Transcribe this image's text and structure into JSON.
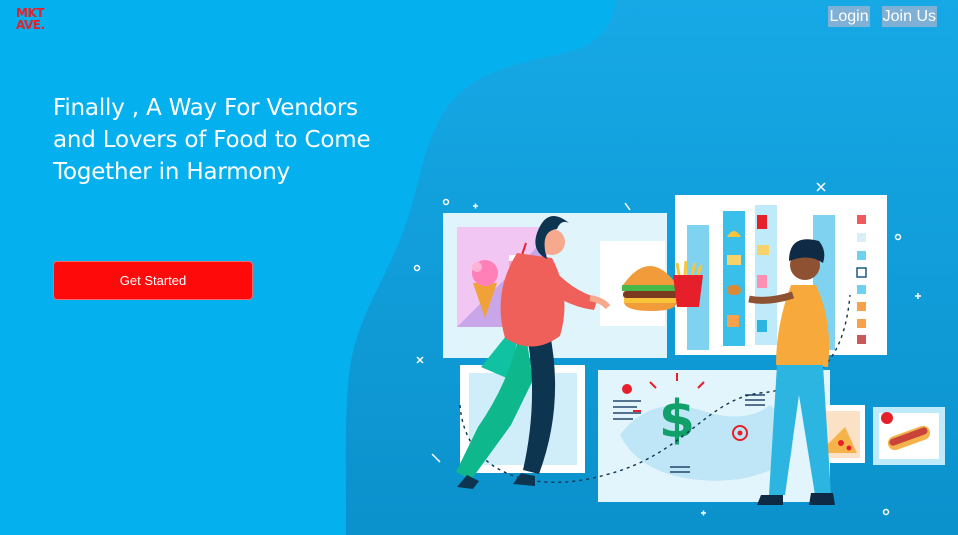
{
  "brand": {
    "logo_line1": "MKT",
    "logo_line2": "AVE."
  },
  "nav": {
    "login_label": "Login",
    "join_label": "Join Us"
  },
  "hero": {
    "title": "Finally , A Way For Vendors and Lovers of Food to Come Together in Harmony",
    "cta_label": "Get Started"
  },
  "illustration": {
    "price_symbol": "$",
    "accent_color": "#ff0a0a",
    "brand_color": "#e5202a",
    "icons": [
      "ice-cream-icon",
      "smoothie-icon",
      "burger-icon",
      "fries-icon",
      "taco-icon",
      "sandwich-icon",
      "soda-icon",
      "pizza-icon",
      "hotdog-icon",
      "dollar-icon"
    ]
  }
}
